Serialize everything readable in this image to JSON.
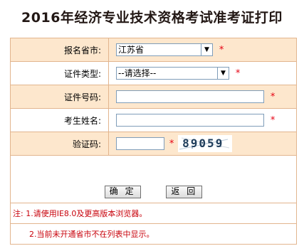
{
  "page": {
    "title": "2016年经济专业技术资格考试准考证打印"
  },
  "form": {
    "province": {
      "label": "报名省市:",
      "value": "江苏省",
      "required_mark": "*"
    },
    "id_type": {
      "label": "证件类型:",
      "value": "--请选择--",
      "required_mark": "*"
    },
    "id_number": {
      "label": "证件号码:",
      "value": "",
      "required_mark": "*"
    },
    "name": {
      "label": "考生姓名:",
      "value": "",
      "required_mark": "*"
    },
    "captcha": {
      "label": "验证码:",
      "value": "",
      "required_mark": "*",
      "image_text": "89059"
    }
  },
  "buttons": {
    "confirm_label": "确 定",
    "back_label": "返 回"
  },
  "notes": {
    "prefix": "注:",
    "line1": "1.请使用IE8.0及更高版本浏览器。",
    "line2": "2.当前未开通省市不在列表中显示。"
  },
  "colors": {
    "band_bg": "#fde7cd",
    "border": "#e2b58e",
    "required": "#e60012",
    "note_text": "#c8000a"
  }
}
